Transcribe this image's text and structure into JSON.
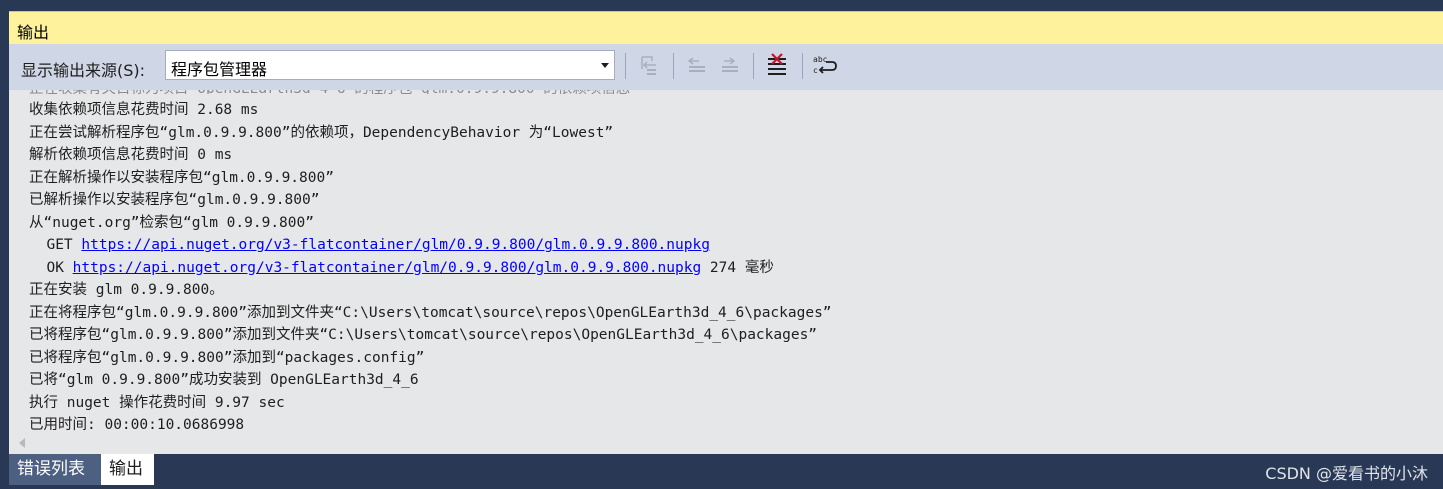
{
  "panel": {
    "title": "输出"
  },
  "toolbar": {
    "source_label": "显示输出来源(S):",
    "source_value": "程序包管理器",
    "buttons": [
      {
        "name": "go-to-previous-message-button",
        "icon": "previous-message-icon",
        "enabled": false
      },
      {
        "name": "find-previous-button",
        "icon": "find-previous-icon",
        "enabled": false
      },
      {
        "name": "find-next-button",
        "icon": "find-next-icon",
        "enabled": false
      },
      {
        "name": "clear-all-button",
        "icon": "clear-all-icon",
        "enabled": true
      },
      {
        "name": "toggle-word-wrap-button",
        "icon": "word-wrap-icon",
        "enabled": true
      }
    ]
  },
  "output": {
    "lines": [
      {
        "text": "收集依赖项信息花费时间 2.68 ms"
      },
      {
        "text": "正在尝试解析程序包“glm.0.9.9.800”的依赖项，DependencyBehavior 为“Lowest”"
      },
      {
        "text": "解析依赖项信息花费时间 0 ms"
      },
      {
        "text": "正在解析操作以安装程序包“glm.0.9.9.800”"
      },
      {
        "text": "已解析操作以安装程序包“glm.0.9.9.800”"
      },
      {
        "text": "从“nuget.org”检索包“glm 0.9.9.800”"
      },
      {
        "prefix": "  GET ",
        "link": "https://api.nuget.org/v3-flatcontainer/glm/0.9.9.800/glm.0.9.9.800.nupkg",
        "suffix": ""
      },
      {
        "prefix": "  OK ",
        "link": "https://api.nuget.org/v3-flatcontainer/glm/0.9.9.800/glm.0.9.9.800.nupkg",
        "suffix": " 274 毫秒"
      },
      {
        "text": "正在安装 glm 0.9.9.800。"
      },
      {
        "text": "正在将程序包“glm.0.9.9.800”添加到文件夹“C:\\Users\\tomcat\\source\\repos\\OpenGLEarth3d_4_6\\packages”"
      },
      {
        "text": "已将程序包“glm.0.9.9.800”添加到文件夹“C:\\Users\\tomcat\\source\\repos\\OpenGLEarth3d_4_6\\packages”"
      },
      {
        "text": "已将程序包“glm.0.9.9.800”添加到“packages.config”"
      },
      {
        "text": "已将“glm 0.9.9.800”成功安装到 OpenGLEarth3d_4_6"
      },
      {
        "text": "执行 nuget 操作花费时间 9.97 sec"
      },
      {
        "text": "已用时间: 00:00:10.0686998"
      }
    ]
  },
  "tabs": [
    {
      "label": "错误列表",
      "active": false
    },
    {
      "label": "输出",
      "active": true
    }
  ],
  "watermark": "CSDN @爱看书的小沐",
  "colors": {
    "title_bar": "#fff29d",
    "toolbar": "#cfd6e5",
    "output_bg": "#e6e7e8",
    "frame": "#293955",
    "link": "#0000ff",
    "clear_icon_red": "#c8102e"
  }
}
